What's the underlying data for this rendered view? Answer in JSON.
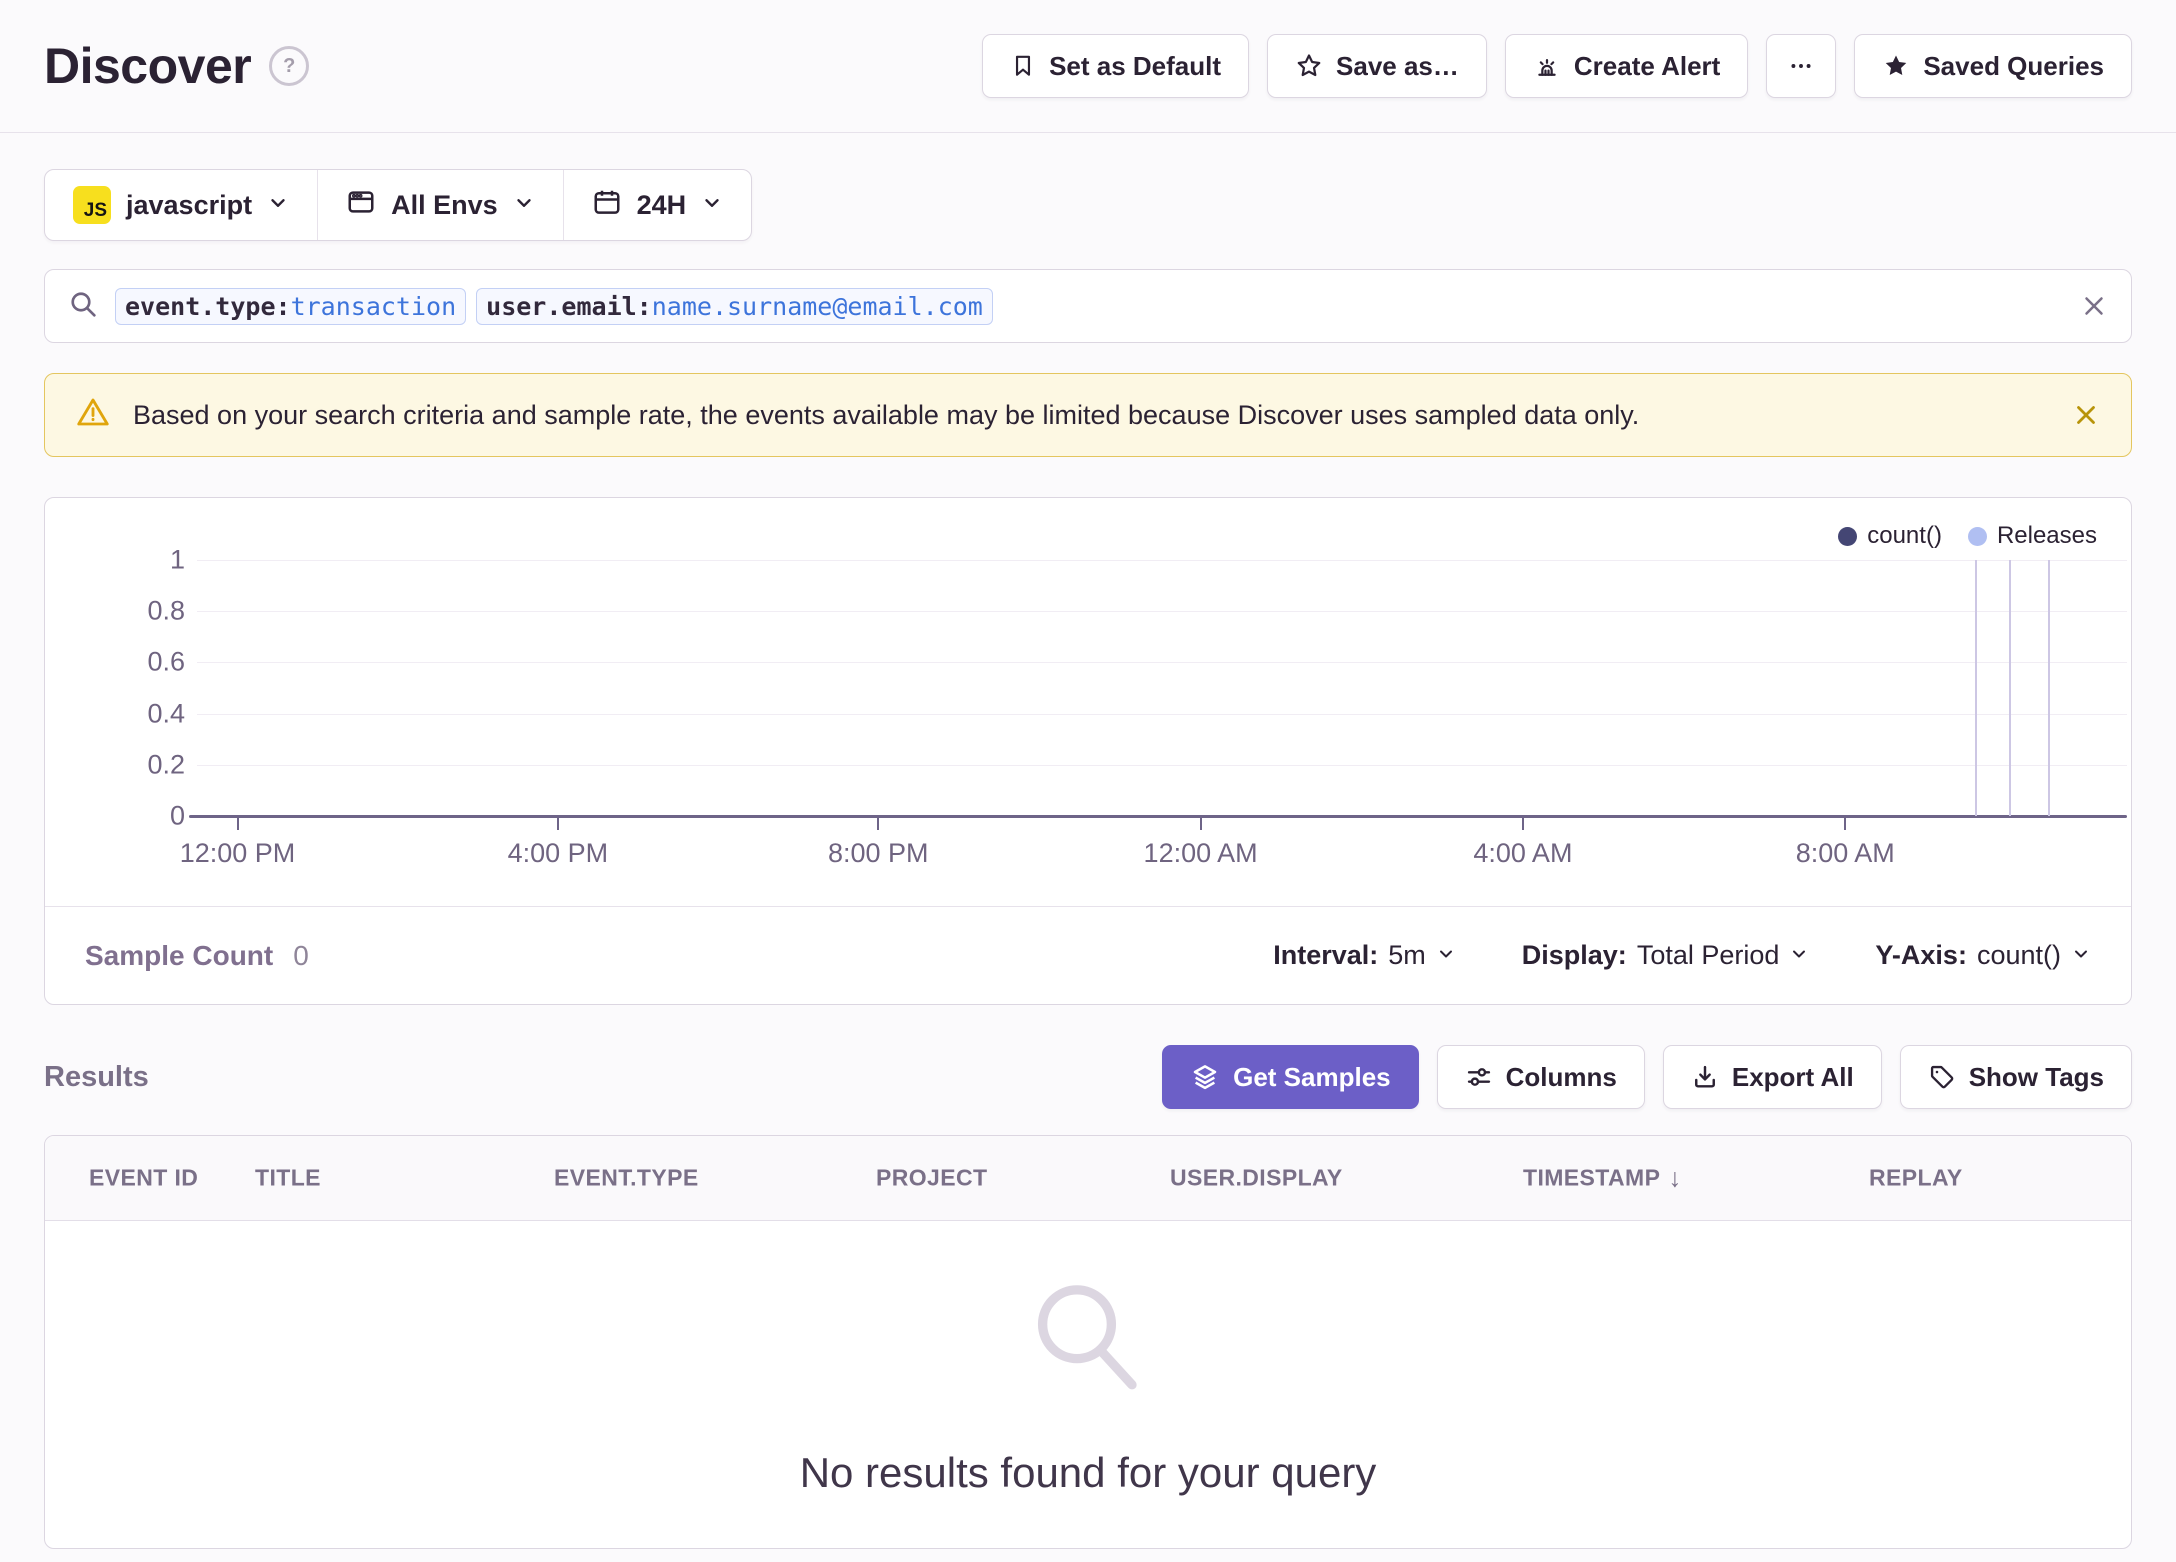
{
  "header": {
    "title": "Discover",
    "help_glyph": "?",
    "actions": {
      "set_default": "Set as Default",
      "save_as": "Save as…",
      "create_alert": "Create Alert",
      "saved_queries": "Saved Queries"
    }
  },
  "filters": {
    "project": {
      "badge": "JS",
      "label": "javascript"
    },
    "environment": "All Envs",
    "date_range": "24H"
  },
  "search": {
    "tokens": [
      {
        "key": "event.type:",
        "value": "transaction"
      },
      {
        "key": "user.email:",
        "value": "name.surname@email.com"
      }
    ]
  },
  "alert": {
    "message": "Based on your search criteria and sample rate, the events available may be limited because Discover uses sampled data only."
  },
  "chart": {
    "legend": [
      {
        "label": "count()",
        "color": "#444674"
      },
      {
        "label": "Releases",
        "color": "#B0BFF2"
      }
    ],
    "y_ticks": [
      {
        "label": "1",
        "pct": 0
      },
      {
        "label": "0.8",
        "pct": 20
      },
      {
        "label": "0.6",
        "pct": 40
      },
      {
        "label": "0.4",
        "pct": 60
      },
      {
        "label": "0.2",
        "pct": 80
      },
      {
        "label": "0",
        "pct": 100
      }
    ],
    "x_ticks": [
      {
        "label": "12:00 PM",
        "pct": 2.1
      },
      {
        "label": "4:00 PM",
        "pct": 18.7
      },
      {
        "label": "8:00 PM",
        "pct": 35.3
      },
      {
        "label": "12:00 AM",
        "pct": 52.0
      },
      {
        "label": "4:00 AM",
        "pct": 68.7
      },
      {
        "label": "8:00 AM",
        "pct": 85.4
      }
    ],
    "releases_pct": [
      92.1,
      93.9,
      95.9
    ],
    "footer": {
      "sample_count_label": "Sample Count",
      "sample_count_value": "0",
      "interval_label": "Interval:",
      "interval_value": "5m",
      "display_label": "Display:",
      "display_value": "Total Period",
      "yaxis_label": "Y-Axis:",
      "yaxis_value": "count()"
    }
  },
  "chart_data": {
    "type": "line",
    "x_ticks": [
      "12:00 PM",
      "4:00 PM",
      "8:00 PM",
      "12:00 AM",
      "4:00 AM",
      "8:00 AM"
    ],
    "ylim": [
      0,
      1
    ],
    "y_ticks": [
      0,
      0.2,
      0.4,
      0.6,
      0.8,
      1
    ],
    "series": [
      {
        "name": "count()",
        "values": []
      }
    ],
    "release_markers_count": 3,
    "legend_position": "top-right",
    "grid": true
  },
  "results": {
    "title": "Results",
    "actions": {
      "get_samples": "Get Samples",
      "columns": "Columns",
      "export_all": "Export All",
      "show_tags": "Show Tags"
    }
  },
  "table": {
    "columns": [
      "EVENT ID",
      "TITLE",
      "EVENT.TYPE",
      "PROJECT",
      "USER.DISPLAY",
      "TIMESTAMP",
      "REPLAY"
    ],
    "sort_column": "TIMESTAMP",
    "sort_arrow": "↓",
    "empty_message": "No results found for your query"
  },
  "colors": {
    "accent_purple": "#6C5FC7",
    "platform_yellow": "#F7DF1E",
    "warning_bg": "#FDF8E3",
    "warning_border": "#E4C65F",
    "token_blue": "#3D74DB",
    "count_series": "#444674",
    "releases_legend": "#B0BFF2",
    "release_marker": "#CDC7E4"
  }
}
